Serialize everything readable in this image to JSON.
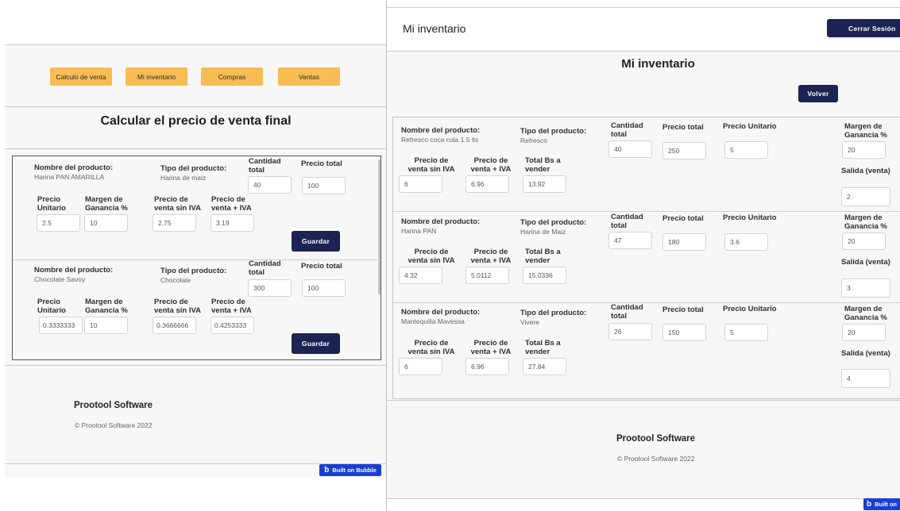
{
  "left": {
    "nav": [
      "Calculo de venta",
      "Mi inventario",
      "Compras",
      "Ventas"
    ],
    "title": "Calcular el precio de venta final",
    "labels": {
      "nombre": "Nombre del producto:",
      "tipo": "Tipo del producto:",
      "cantidad": "Cantidad total",
      "precio_total": "Precio total",
      "precio_unitario": "Precio Unitario",
      "margen": "Margen de Ganancia %",
      "sin_iva": "Precio de venta sin IVA",
      "mas_iva": "Precio de venta + IVA",
      "guardar": "Guardar"
    },
    "rows": [
      {
        "nombre": "Harina PAN AMARILLA",
        "tipo": "Harina de maiz",
        "cantidad": "40",
        "precio_total": "100",
        "unitario": "2.5",
        "margen": "10",
        "sin_iva": "2.75",
        "mas_iva": "3.19"
      },
      {
        "nombre": "Chocolate Savoy",
        "tipo": "Chocolate",
        "cantidad": "300",
        "precio_total": "100",
        "unitario": "0.3333333",
        "margen": "10",
        "sin_iva": "0.3666666",
        "mas_iva": "0.4253333"
      }
    ],
    "footer": {
      "brand": "Prootool Software",
      "copy": "© Prootool Software 2022"
    },
    "bubble": "Built on Bubble"
  },
  "right": {
    "header_title": "Mi inventario",
    "logout": "Cerrar Sesión",
    "page_title": "Mi inventario",
    "volver": "Volver",
    "labels": {
      "nombre": "Nombre del producto:",
      "tipo": "Tipo del producto:",
      "cantidad": "Cantidad total",
      "precio_total": "Precio total",
      "precio_unitario": "Precio Unitario",
      "margen": "Margen de Ganancia %",
      "sin_iva": "Precio de venta sin IVA",
      "mas_iva": "Precio de venta + IVA",
      "total_bs": "Total Bs a vender",
      "salida": "Salida (venta)"
    },
    "rows": [
      {
        "nombre": "Refresco coca cola 1.5 lts",
        "tipo": "Refresco",
        "cantidad": "40",
        "precio_total": "250",
        "unitario": "5",
        "margen": "20",
        "salida": "2",
        "sin_iva": "6",
        "mas_iva": "6.96",
        "total_bs": "13.92"
      },
      {
        "nombre": "Harina PAN",
        "tipo": "Harina de Maiz",
        "cantidad": "47",
        "precio_total": "180",
        "unitario": "3.6",
        "margen": "20",
        "salida": "3",
        "sin_iva": "4.32",
        "mas_iva": "5.0112",
        "total_bs": "15.0336"
      },
      {
        "nombre": "Mantequilla Mavessa",
        "tipo": "Vivere",
        "cantidad": "26",
        "precio_total": "150",
        "unitario": "5",
        "margen": "20",
        "salida": "4",
        "sin_iva": "6",
        "mas_iva": "6.96",
        "total_bs": "27.84"
      }
    ],
    "footer": {
      "brand": "Prootool Software",
      "copy": "© Prootool Software 2022"
    },
    "bubble": "Built on"
  }
}
